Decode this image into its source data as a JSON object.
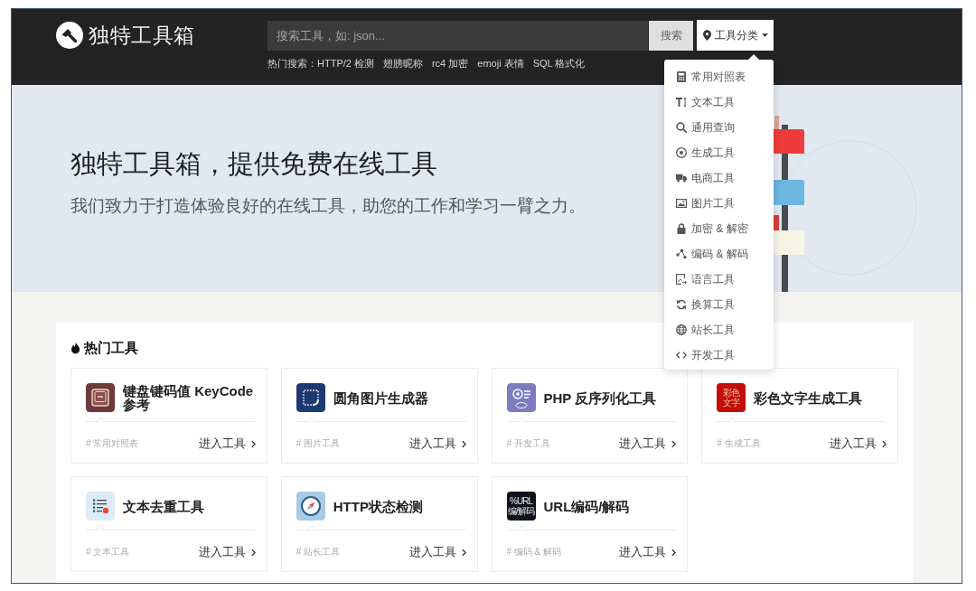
{
  "header": {
    "logo": {
      "text": "独特工具箱"
    },
    "search": {
      "placeholder": "搜索工具，如: json...",
      "button": "搜索"
    },
    "category_menu": {
      "label": "工具分类",
      "expanded": true,
      "items": [
        {
          "kind": "reference",
          "label": "常用对照表"
        },
        {
          "kind": "text",
          "label": "文本工具"
        },
        {
          "kind": "query",
          "label": "通用查询"
        },
        {
          "kind": "generate",
          "label": "生成工具"
        },
        {
          "kind": "ecommerce",
          "label": "电商工具"
        },
        {
          "kind": "image",
          "label": "图片工具"
        },
        {
          "kind": "crypto",
          "label": "加密 & 解密"
        },
        {
          "kind": "codec",
          "label": "编码 & 解码"
        },
        {
          "kind": "language",
          "label": "语言工具"
        },
        {
          "kind": "convert",
          "label": "换算工具"
        },
        {
          "kind": "webmaster",
          "label": "站长工具"
        },
        {
          "kind": "dev",
          "label": "开发工具"
        }
      ]
    },
    "hot_searches": {
      "label": "热门搜索：",
      "links": [
        "HTTP/2 检测",
        "翅膀昵称",
        "rc4 加密",
        "emoji 表情",
        "SQL 格式化"
      ]
    }
  },
  "hero": {
    "title": "独特工具箱，提供免费在线工具",
    "subtitle": "我们致力于打造体验良好的在线工具，助您的工作和学习一臂之力。"
  },
  "hot_tools": {
    "heading": "热门工具",
    "cards": [
      {
        "kind": "keycode",
        "title": "键盘键码值 KeyCode 参考",
        "tag": "# 常用对照表",
        "link": "进入工具"
      },
      {
        "kind": "rounded-image",
        "title": "圆角图片生成器",
        "tag": "# 图片工具",
        "link": "进入工具"
      },
      {
        "kind": "php",
        "title": "PHP 反序列化工具",
        "tag": "# 开发工具",
        "link": "进入工具"
      },
      {
        "kind": "color-text",
        "logo_text": [
          "彩色",
          "文字"
        ],
        "title": "彩色文字生成工具",
        "tag": "# 生成工具",
        "link": "进入工具"
      },
      {
        "kind": "dedupe",
        "title": "文本去重工具",
        "tag": "# 文本工具",
        "link": "进入工具"
      },
      {
        "kind": "http-status",
        "title": "HTTP状态检测",
        "tag": "# 站长工具",
        "link": "进入工具"
      },
      {
        "kind": "url-codec",
        "logo_text": [
          "%URL",
          "编/解码"
        ],
        "title": "URL编码/解码",
        "tag": "# 编码 & 解码",
        "link": "进入工具"
      }
    ]
  }
}
